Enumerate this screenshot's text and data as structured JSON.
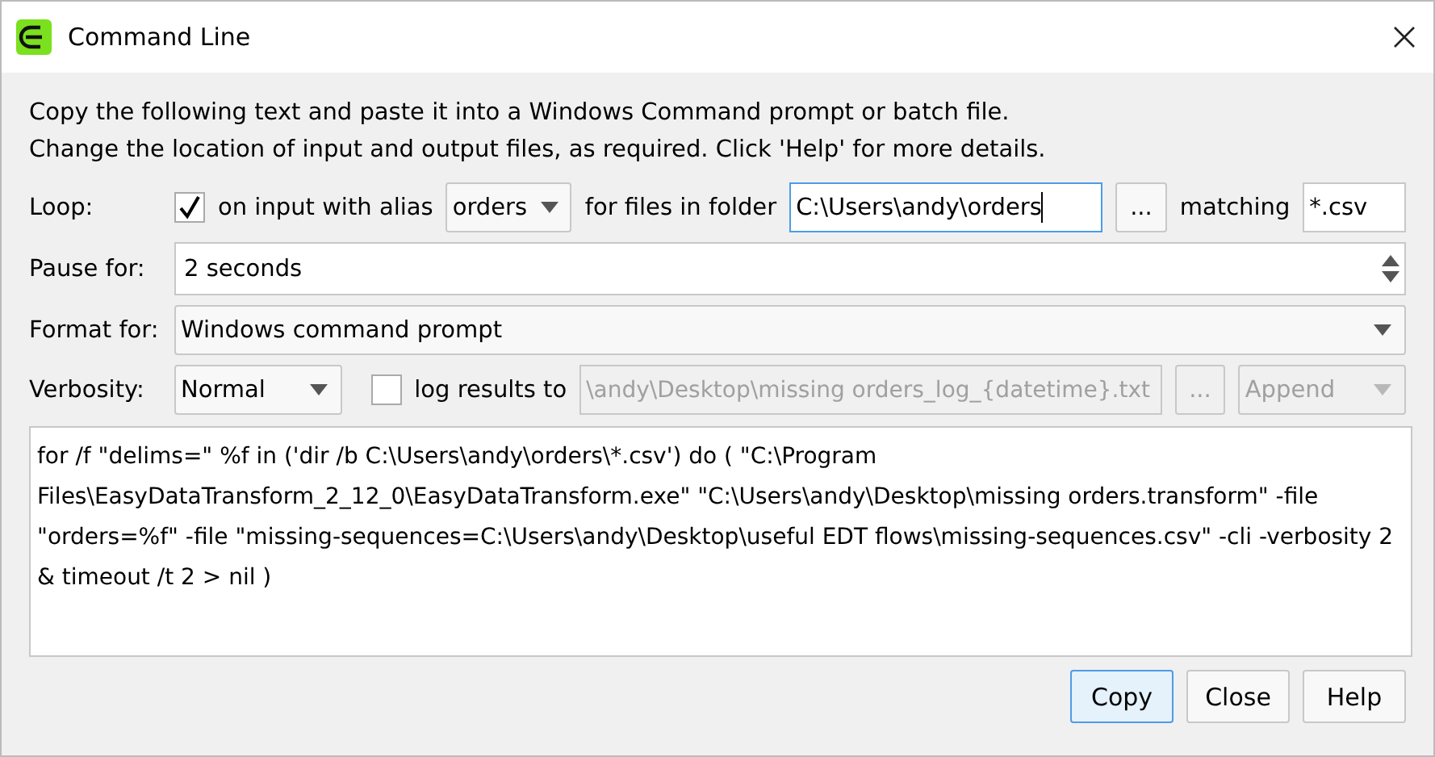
{
  "window": {
    "title": "Command Line"
  },
  "instructions": [
    "Copy the following text and paste it into a Windows Command prompt or batch file.",
    "Change the location of input and output files, as required. Click 'Help' for more details."
  ],
  "loop": {
    "label": "Loop:",
    "checked": true,
    "check_label": "on input with alias",
    "alias": "orders",
    "folder_label": "for files in folder",
    "folder": "C:\\Users\\andy\\orders",
    "folder_focused": true,
    "browse": "...",
    "matching_label": "matching",
    "pattern": "*.csv"
  },
  "pause": {
    "label": "Pause for:",
    "value": "2 seconds"
  },
  "format": {
    "label": "Format for:",
    "value": "Windows command prompt"
  },
  "verbosity": {
    "label": "Verbosity:",
    "value": "Normal",
    "log_checked": false,
    "log_label": "log results to",
    "log_file": "\\andy\\Desktop\\missing orders_log_{datetime}.txt",
    "browse": "...",
    "mode": "Append",
    "disabled": true
  },
  "command": "for /f \"delims=\" %f in ('dir /b C:\\Users\\andy\\orders\\*.csv') do ( \"C:\\Program Files\\EasyDataTransform_2_12_0\\EasyDataTransform.exe\" \"C:\\Users\\andy\\Desktop\\missing orders.transform\" -file \"orders=%f\" -file \"missing-sequences=C:\\Users\\andy\\Desktop\\useful EDT flows\\missing-sequences.csv\" -cli -verbosity 2 & timeout /t 2 > nil )",
  "buttons": [
    {
      "label": "Copy",
      "default": true
    },
    {
      "label": "Close",
      "default": false
    },
    {
      "label": "Help",
      "default": false
    }
  ]
}
